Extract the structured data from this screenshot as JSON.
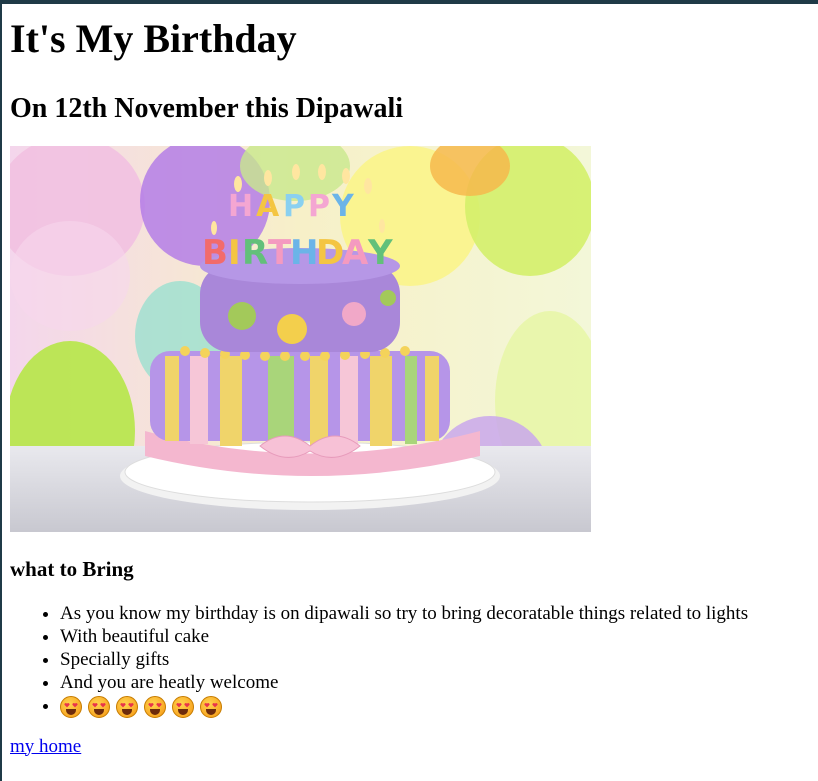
{
  "page": {
    "title": "It's My Birthday",
    "subtitle": "On 12th November this Dipawali",
    "image_alt": "HAPPY BIRTHDAY cake",
    "section_heading": "what to Bring",
    "items": [
      "As you know my birthday is on dipawali so try to bring decoratable things related to lights",
      "With beautiful cake",
      "Specially gifts",
      "And you are heatly welcome"
    ],
    "emoji_count": 6,
    "emoji_name": "smiling-face-with-heart-eyes",
    "link_label": "my home"
  },
  "colors": {
    "frame": "#1f3a47",
    "link": "#0000ee"
  }
}
